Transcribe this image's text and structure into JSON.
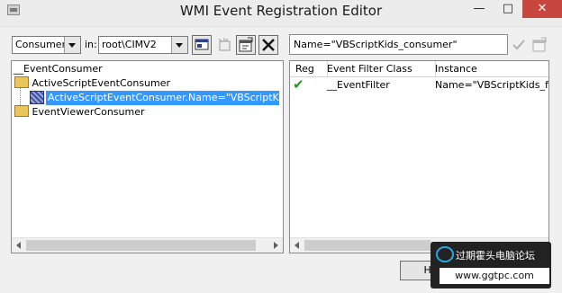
{
  "window": {
    "title": "WMI Event Registration Editor",
    "min_glyph": "—",
    "max_glyph": "□",
    "close_glyph": "✕"
  },
  "toolbar": {
    "class_type": "Consumers",
    "in_label": "in:",
    "namespace": "root\\CIMV2"
  },
  "tree": {
    "root": "__EventConsumer",
    "items": [
      {
        "label": "ActiveScriptEventConsumer",
        "icon": "folder-icon"
      },
      {
        "label": "ActiveScriptEventConsumer.Name=\"VBScriptKids_consumer\"",
        "icon": "instance-icon",
        "selected": true
      },
      {
        "label": "EventViewerConsumer",
        "icon": "folder-icon"
      }
    ]
  },
  "right_panel": {
    "selected_name": "Name=\"VBScriptKids_consumer\"",
    "columns": [
      "Reg",
      "Event Filter Class",
      "Instance"
    ],
    "rows": [
      {
        "reg": "✔",
        "class": "__EventFilter",
        "instance": "Name=\"VBScriptKids_filter\""
      }
    ]
  },
  "buttons": {
    "help": "Help"
  },
  "watermark": {
    "text": "过期霍头电脑论坛",
    "url": "www.ggtpc.com"
  },
  "colors": {
    "selection": "#3399ff",
    "check": "#1a9a1a"
  }
}
